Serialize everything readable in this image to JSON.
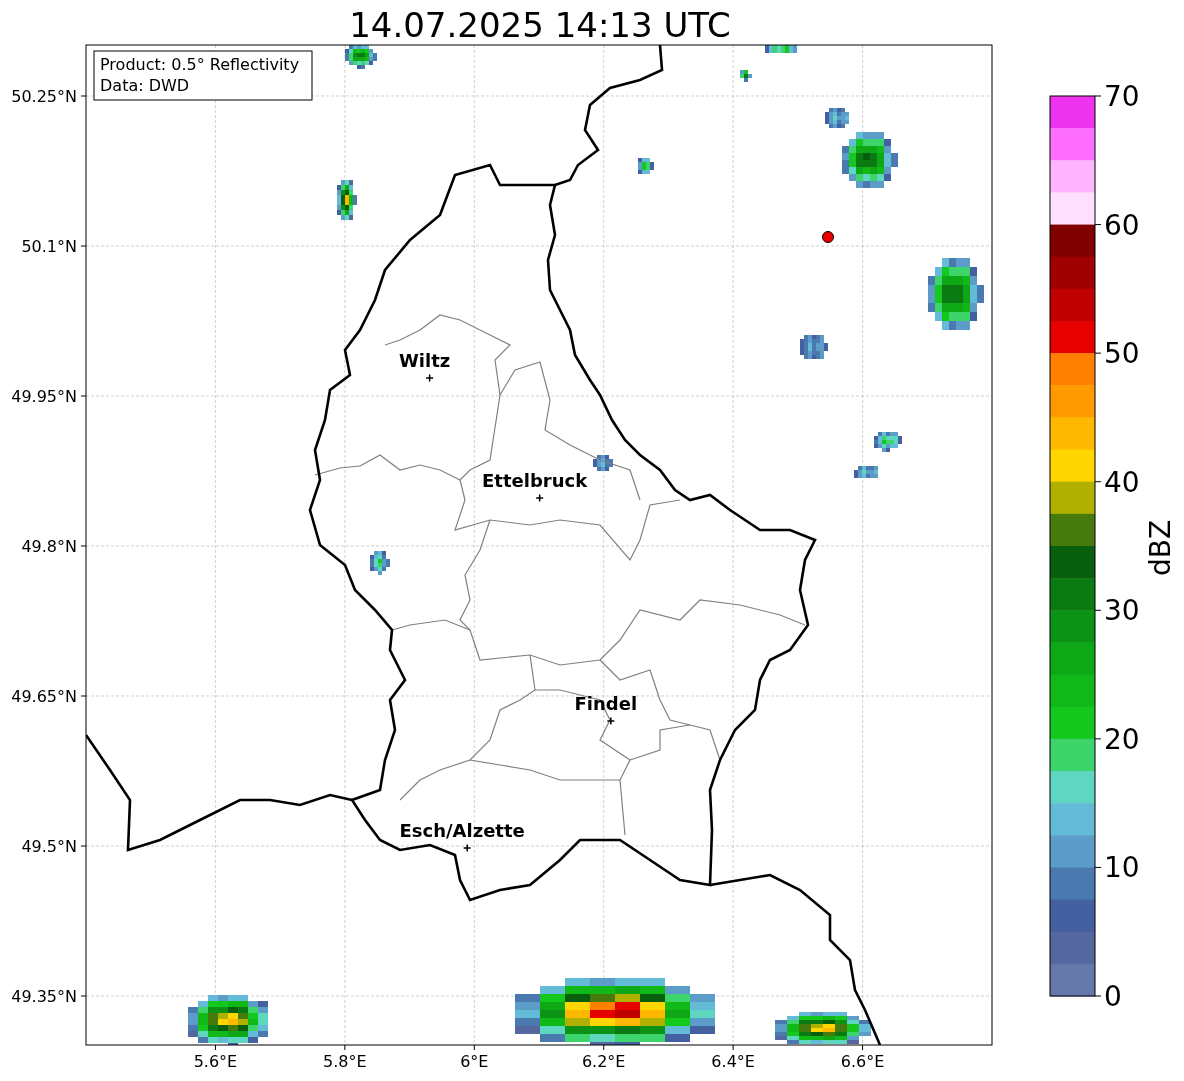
{
  "title": "14.07.2025 14:13 UTC",
  "info_box": [
    "Product: 0.5° Reflectivity",
    "Data: DWD"
  ],
  "map": {
    "y_ticks": [
      "50.25°N",
      "50.1°N",
      "49.95°N",
      "49.8°N",
      "49.65°N",
      "49.5°N",
      "49.35°N"
    ],
    "x_ticks": [
      "5.6°E",
      "5.8°E",
      "6°E",
      "6.2°E",
      "6.4°E",
      "6.6°E"
    ],
    "cities": [
      {
        "name": "Wiltz"
      },
      {
        "name": "Ettelbruck"
      },
      {
        "name": "Findel"
      },
      {
        "name": "Esch/Alzette"
      }
    ]
  },
  "colorbar": {
    "label": "dBZ",
    "ticks": [
      "70",
      "60",
      "50",
      "40",
      "30",
      "20",
      "10",
      "0"
    ],
    "bins": [
      {
        "color": "#ee33ee"
      },
      {
        "color": "#ff6eff"
      },
      {
        "color": "#ffb4ff"
      },
      {
        "color": "#ffe0ff"
      },
      {
        "color": "#800000"
      },
      {
        "color": "#a00000"
      },
      {
        "color": "#c00000"
      },
      {
        "color": "#e60000"
      },
      {
        "color": "#ff7f00"
      },
      {
        "color": "#ff9a00"
      },
      {
        "color": "#ffb800"
      },
      {
        "color": "#ffd600"
      },
      {
        "color": "#b0b000"
      },
      {
        "color": "#477a0c"
      },
      {
        "color": "#075e0c"
      },
      {
        "color": "#0b7a12"
      },
      {
        "color": "#0c9214"
      },
      {
        "color": "#0ea816"
      },
      {
        "color": "#10b818"
      },
      {
        "color": "#14c81e"
      },
      {
        "color": "#3dd46c"
      },
      {
        "color": "#5fd6c0"
      },
      {
        "color": "#63bbd8"
      },
      {
        "color": "#5b9dc8"
      },
      {
        "color": "#4a79b0"
      },
      {
        "color": "#4560a0"
      },
      {
        "color": "#55679f"
      },
      {
        "color": "#6677aa"
      }
    ]
  }
}
